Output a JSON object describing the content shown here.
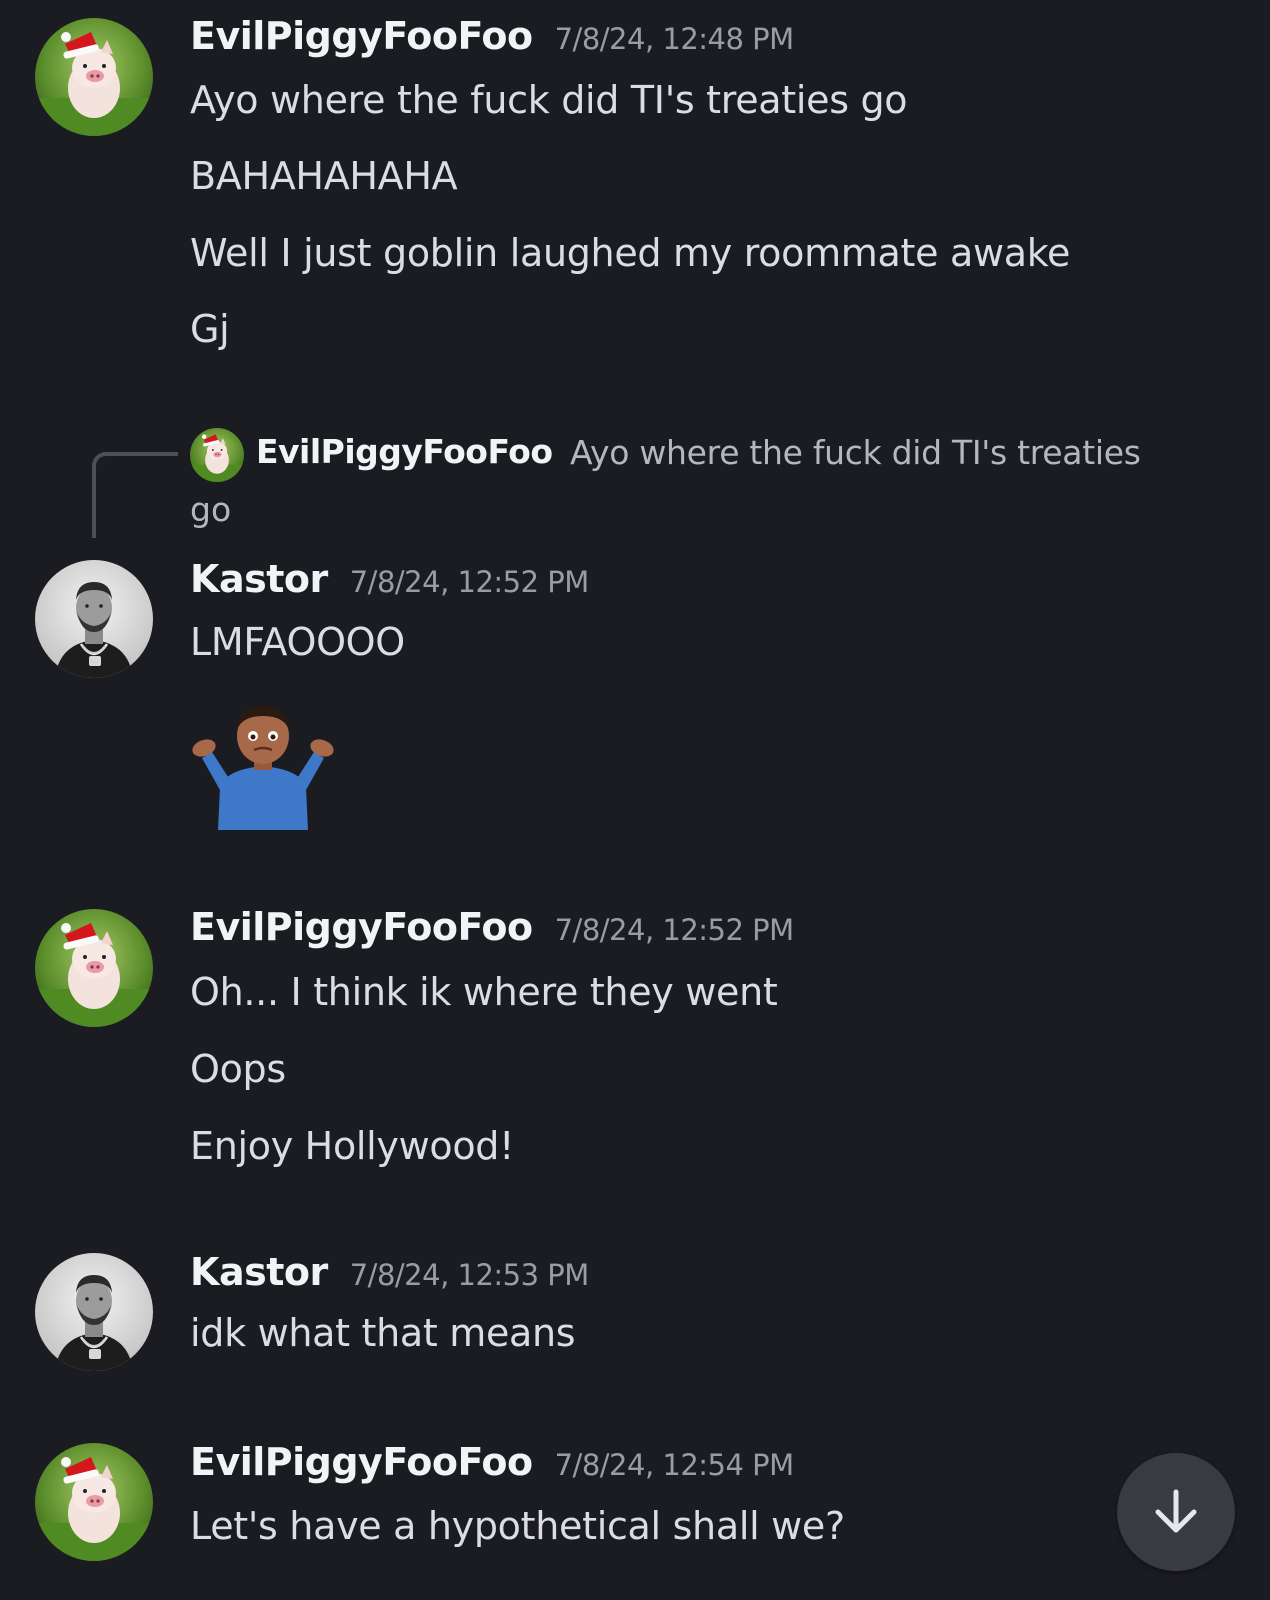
{
  "messages": [
    {
      "author": "EvilPiggyFooFoo",
      "timestamp": "7/8/24, 12:48 PM",
      "avatar": "pig-santa-hat",
      "lines": [
        "Ayo where the fuck did TI's treaties go",
        "BAHAHAHAHA",
        "Well I just goblin laughed my roommate awake",
        "Gj"
      ]
    },
    {
      "reply_to": {
        "author": "EvilPiggyFooFoo",
        "text_part1": "Ayo where the fuck did TI's treaties",
        "text_part2": "go"
      },
      "author": "Kastor",
      "timestamp": "7/8/24, 12:52 PM",
      "avatar": "man-grayscale-portrait",
      "lines": [
        "LMFAOOOO"
      ],
      "emoji": "person-shrugging"
    },
    {
      "author": "EvilPiggyFooFoo",
      "timestamp": "7/8/24, 12:52 PM",
      "avatar": "pig-santa-hat",
      "lines": [
        "Oh... I think ik where they went",
        "Oops",
        "Enjoy Hollywood!"
      ]
    },
    {
      "author": "Kastor",
      "timestamp": "7/8/24, 12:53 PM",
      "avatar": "man-grayscale-portrait",
      "lines": [
        "idk what that means"
      ]
    },
    {
      "author": "EvilPiggyFooFoo",
      "timestamp": "7/8/24, 12:54 PM",
      "avatar": "pig-santa-hat",
      "lines": [
        "Let's have a hypothetical shall we?"
      ]
    }
  ],
  "scroll_button": {
    "icon": "arrow-down-icon"
  },
  "colors": {
    "background": "#1b1c21",
    "username": "#f2f3f5",
    "timestamp": "#9a9ca5",
    "text": "#dcdde2",
    "reply_text": "#b5b7be",
    "scroll_button_bg": "#3a3b42"
  }
}
